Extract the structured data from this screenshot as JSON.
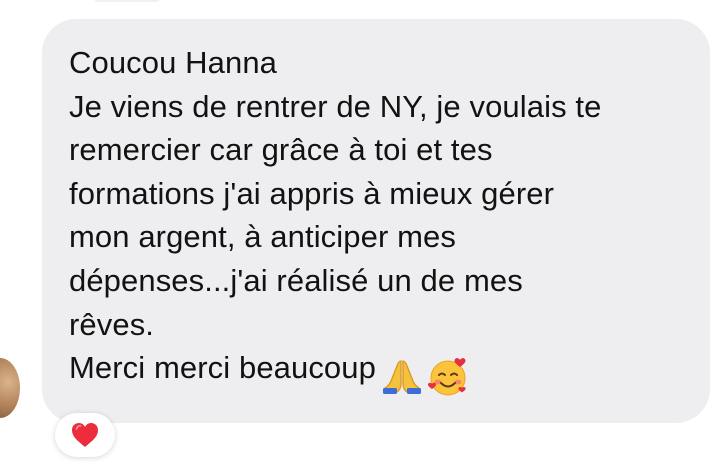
{
  "message": {
    "greeting": "Coucou Hanna",
    "lines": [
      "Je viens de rentrer de NY, je voulais te",
      "remercier car grâce à toi et tes",
      "formations j'ai appris à mieux gérer",
      "mon argent, à anticiper mes",
      "dépenses...j'ai réalisé un de mes",
      "rêves."
    ],
    "closing": "Merci merci beaucoup",
    "emojis": [
      "folded-hands-icon",
      "smiling-face-with-hearts-icon"
    ]
  },
  "reaction": {
    "icon": "red-heart-icon",
    "color": "#ed2d3c"
  },
  "colors": {
    "bubble": "#eeeef0",
    "text": "#121212"
  }
}
